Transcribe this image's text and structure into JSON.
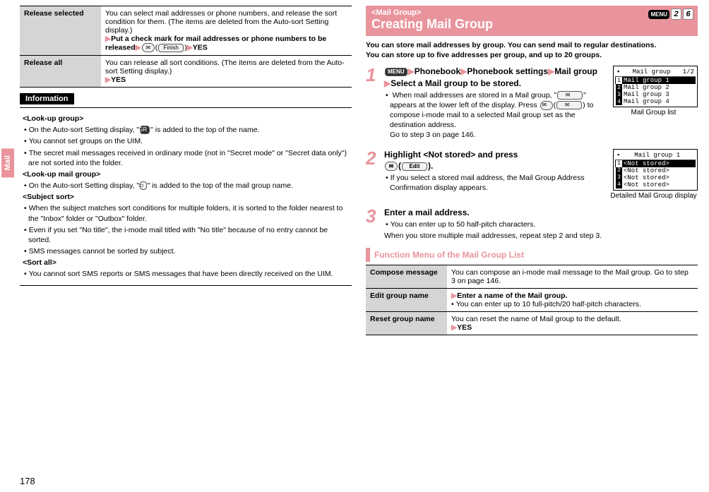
{
  "sideTab": "Mail",
  "pageNumber": "178",
  "leftTable": [
    {
      "name": "Release selected",
      "desc": "You can select mail addresses or phone numbers, and release the sort condition for them. (The items are deleted from the Auto-sort Setting display.)",
      "action_prefix": "Put a check mark for mail addresses or phone numbers to be released",
      "action_suffix": "YES",
      "mid_icon_label": "Finish"
    },
    {
      "name": "Release all",
      "desc": "You can release all sort conditions. (The items are deleted from the Auto-sort Setting display.)",
      "action_suffix": "YES"
    }
  ],
  "infoTitle": "Information",
  "info": {
    "g1_title": "<Look-up group>",
    "g1_b1_a": "On the Auto-sort Setting display, \"",
    "g1_b1_b": "\" is added to the top of the name.",
    "g1_icon": "GR",
    "g1_b2": "You cannot set groups on the UIM.",
    "g1_b3": "The secret mail messages received in ordinary mode (not in \"Secret mode\" or \"Secret data only\") are not sorted into the folder.",
    "g2_title": "<Look-up mail group>",
    "g2_b1_a": "On the Auto-sort Setting display, \"",
    "g2_b1_b": "\" is added to the top of the mail group name.",
    "g3_title": "<Subject sort>",
    "g3_b1": "When the subject matches sort conditions for multiple folders, it is sorted to the folder nearest to the \"Inbox\" folder or \"Outbox\" folder.",
    "g3_b2": "Even if you set \"No title\", the i-mode mail titled with \"No title\" because of no entry cannot be sorted.",
    "g3_b3": "SMS messages cannot be sorted by subject.",
    "g4_title": "<Sort all>",
    "g4_b1": "You cannot sort SMS reports or SMS messages that have been directly received on the UIM."
  },
  "right": {
    "crumb": "<Mail Group>",
    "title": "Creating Mail Group",
    "badgeMenu": "MENU",
    "badgeNums": [
      "2",
      "6"
    ],
    "intro1": "You can store mail addresses by group. You can send mail to regular destinations.",
    "intro2": "You can store up to five addresses per group, and up to 20 groups."
  },
  "steps": {
    "s1": {
      "parts": [
        "Phonebook",
        "Phonebook settings",
        "Mail group"
      ],
      "line2": "Select a Mail group to be stored.",
      "note_a": "When mail addresses are stored in a Mail group, \"",
      "note_b": "\" appears at the lower left of the display. Press ",
      "note_c": " to compose i-mode mail to a selected Mail group set as the destination address.",
      "note_d": "Go to step 3 on page 146.",
      "screenshot_title": "Mail group",
      "screenshot_page": "1/2",
      "screenshot_rows": [
        "Mail group 1",
        "Mail group 2",
        "Mail group 3",
        "Mail group 4"
      ],
      "caption": "Mail Group list"
    },
    "s2": {
      "main_a": "Highlight <Not stored> and press ",
      "edit_label": "Edit",
      "main_b": ".",
      "note": "If you select a stored mail address, the Mail Group Address Confirmation display appears.",
      "screenshot_title": "Mail group 1",
      "screenshot_rows": [
        "<Not stored>",
        "<Not stored>",
        "<Not stored>",
        "<Not stored>"
      ],
      "caption": "Detailed Mail Group display"
    },
    "s3": {
      "main": "Enter a mail address.",
      "note1": "You can enter up to 50 half-pitch characters.",
      "note2": "When you store multiple mail addresses, repeat step 2 and step 3."
    }
  },
  "funcTitle": "Function Menu of the Mail Group List",
  "funcTable": {
    "r1_name": "Compose message",
    "r1_desc": "You can compose an i-mode mail message to the Mail group. Go to step 3 on page 146.",
    "r2_name": "Edit group name",
    "r2_action": "Enter a name of the Mail group.",
    "r2_note": "You can enter up to 10 full-pitch/20 half-pitch characters.",
    "r3_name": "Reset group name",
    "r3_desc": "You can reset the name of Mail group to the default.",
    "r3_action": "YES"
  }
}
